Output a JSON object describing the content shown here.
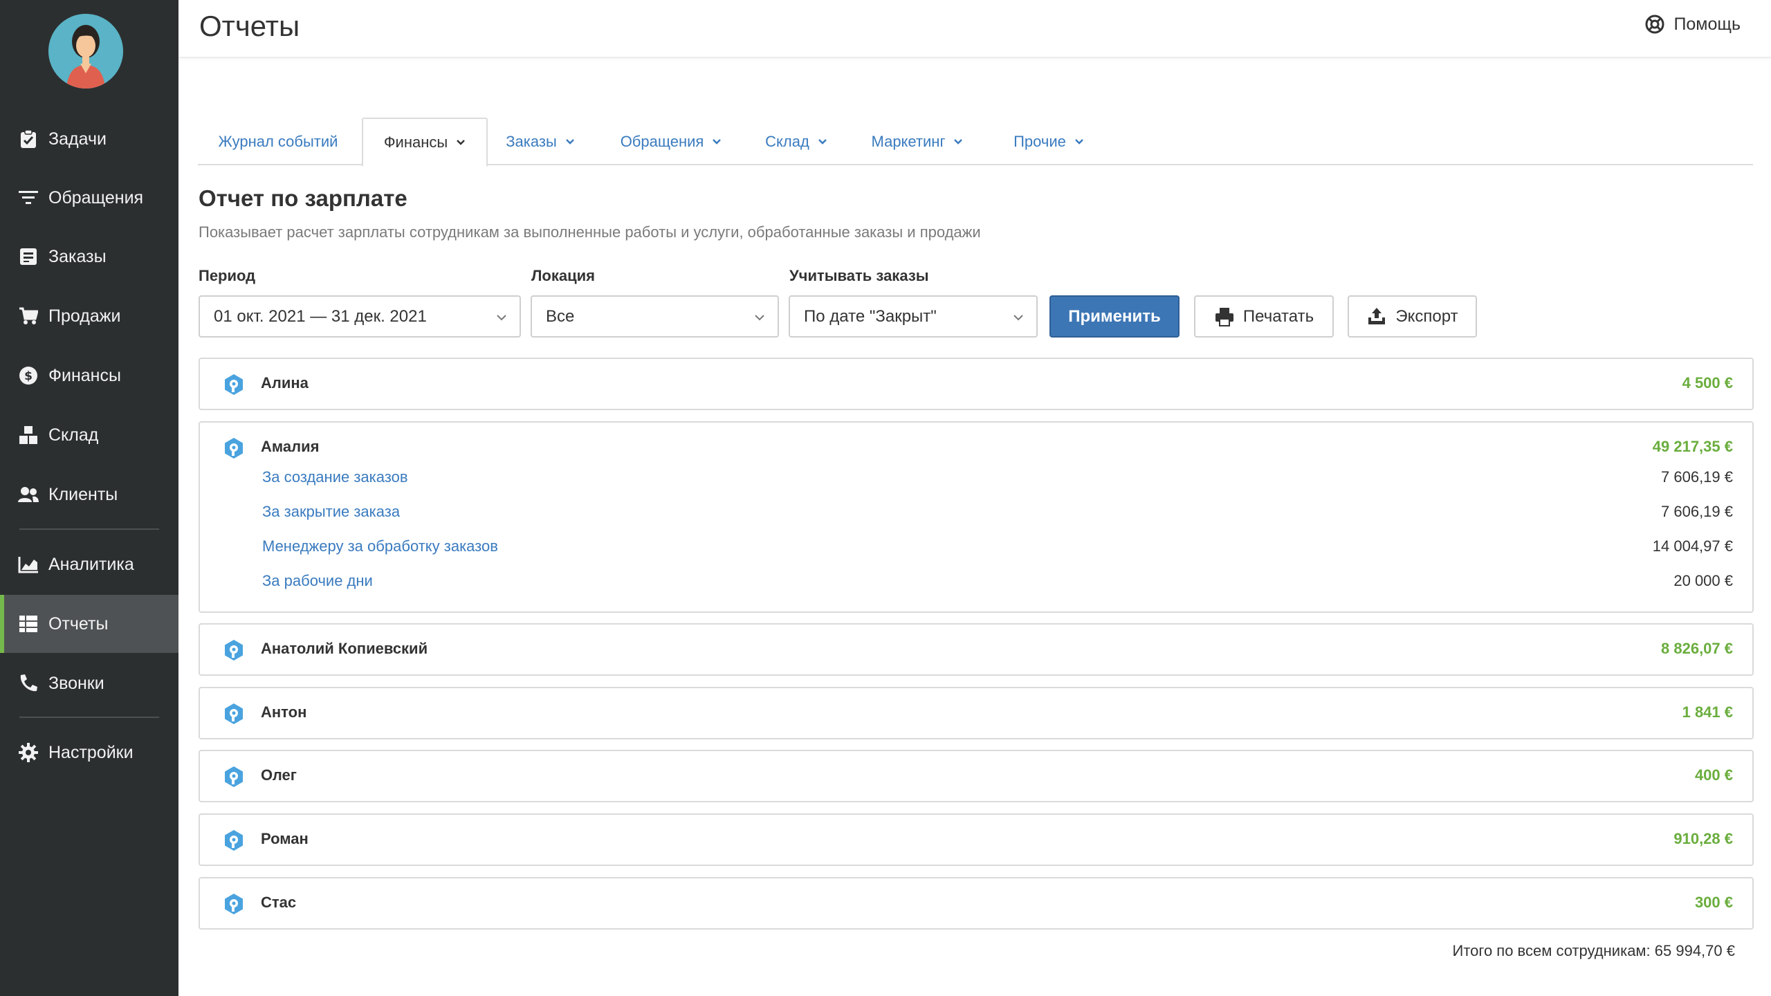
{
  "sidebar": {
    "items": [
      {
        "label": "Задачи",
        "icon": "clipboard-check-icon"
      },
      {
        "label": "Обращения",
        "icon": "filter-icon"
      },
      {
        "label": "Заказы",
        "icon": "orders-icon"
      },
      {
        "label": "Продажи",
        "icon": "cart-icon"
      },
      {
        "label": "Финансы",
        "icon": "dollar-icon"
      },
      {
        "label": "Склад",
        "icon": "boxes-icon"
      },
      {
        "label": "Клиенты",
        "icon": "users-icon"
      },
      {
        "label": "Аналитика",
        "icon": "chart-area-icon"
      },
      {
        "label": "Отчеты",
        "icon": "table-icon",
        "active": true
      },
      {
        "label": "Звонки",
        "icon": "phone-icon"
      },
      {
        "label": "Настройки",
        "icon": "gear-icon"
      }
    ]
  },
  "header": {
    "title": "Отчеты",
    "help_label": "Помощь"
  },
  "tabs": [
    {
      "label": "Журнал событий",
      "has_dropdown": false
    },
    {
      "label": "Финансы",
      "has_dropdown": true,
      "active": true
    },
    {
      "label": "Заказы",
      "has_dropdown": true
    },
    {
      "label": "Обращения",
      "has_dropdown": true
    },
    {
      "label": "Склад",
      "has_dropdown": true
    },
    {
      "label": "Маркетинг",
      "has_dropdown": true
    },
    {
      "label": "Прочие",
      "has_dropdown": true
    }
  ],
  "report": {
    "title": "Отчет по зарплате",
    "description": "Показывает расчет зарплаты сотрудникам за выполненные работы и услуги, обработанные заказы и продажи"
  },
  "filters": {
    "period_label": "Период",
    "period_value": "01 окт. 2021 — 31 дек. 2021",
    "location_label": "Локация",
    "location_value": "Все",
    "orders_label": "Учитывать заказы",
    "orders_value": "По дате \"Закрыт\"",
    "apply_label": "Применить",
    "print_label": "Печатать",
    "export_label": "Экспорт"
  },
  "employees": [
    {
      "name": "Алина",
      "total": "4 500 €"
    },
    {
      "name": "Амалия",
      "total": "49 217,35 €",
      "items": [
        {
          "label": "За создание заказов",
          "value": "7 606,19 €"
        },
        {
          "label": "За закрытие заказа",
          "value": "7 606,19 €"
        },
        {
          "label": "Менеджеру за обработку заказов",
          "value": "14 004,97 €"
        },
        {
          "label": "За рабочие дни",
          "value": "20 000 €"
        }
      ]
    },
    {
      "name": "Анатолий Копиевский",
      "total": "8 826,07 €"
    },
    {
      "name": "Антон",
      "total": "1 841 €"
    },
    {
      "name": "Олег",
      "total": "400 €"
    },
    {
      "name": "Роман",
      "total": "910,28 €"
    },
    {
      "name": "Стас",
      "total": "300 €"
    }
  ],
  "grand_total": "Итого по всем сотрудникам: 65 994,70 €",
  "colors": {
    "sidebar_bg": "#2c2f30",
    "active_accent": "#75b84c",
    "link": "#3a7bbf",
    "primary_button": "#3d76b5",
    "amount_green": "#6aad3d"
  }
}
